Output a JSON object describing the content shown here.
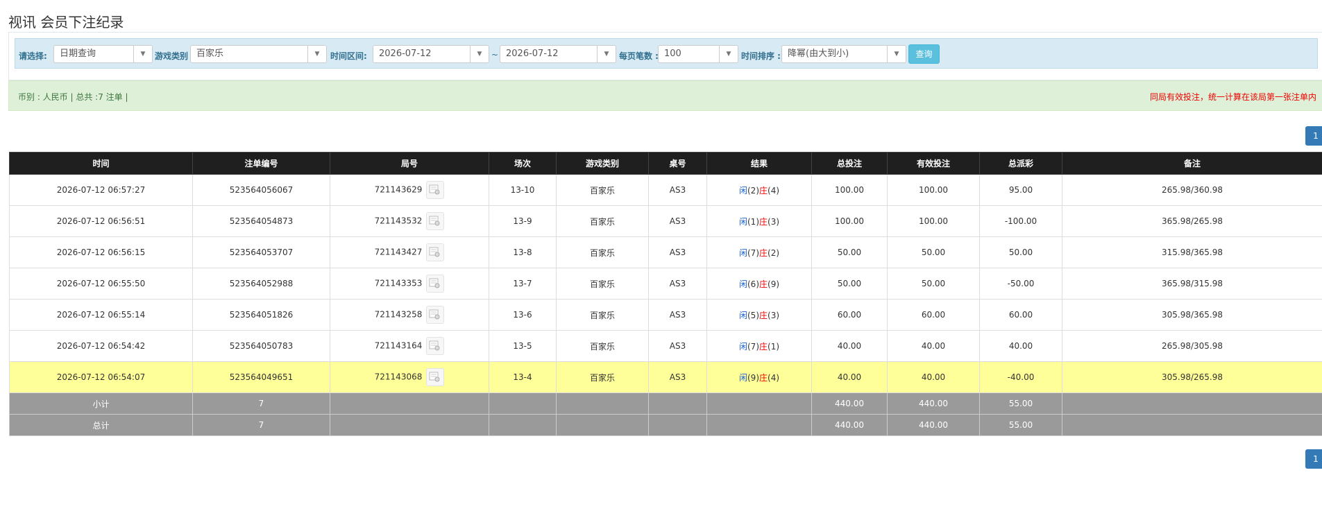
{
  "page": {
    "title": "视讯 会员下注纪录"
  },
  "filters": {
    "select_label": "请选择:",
    "select_value": "日期查询",
    "game_label": "游戏类别",
    "game_value": "百家乐",
    "range_label": "时间区间:",
    "date_from": "2026-07-12",
    "tilde": "~",
    "date_to": "2026-07-12",
    "per_page_label": "每页笔数 :",
    "per_page_value": "100",
    "sort_label": "时间排序 :",
    "sort_value": "降幂(由大到小)",
    "query_button": "查询",
    "dropdown_icon": "caret-down-icon"
  },
  "info": {
    "summary": "币别 : 人民币 | 总共 :7 注单 |",
    "notice": "同局有效投注，统一计算在该局第一张注单内"
  },
  "pagination": {
    "page": "1"
  },
  "table": {
    "headers": [
      "时间",
      "注单编号",
      "局号",
      "场次",
      "游戏类别",
      "桌号",
      "结果",
      "总投注",
      "有效投注",
      "总派彩",
      "备注"
    ],
    "rows": [
      {
        "time": "2026-07-12 06:57:27",
        "bet_no": "523564056067",
        "round_no": "721143629",
        "session": "13-10",
        "game": "百家乐",
        "table": "AS3",
        "player_label": "闲",
        "player_val": "(2)",
        "banker_label": "庄",
        "banker_val": "(4)",
        "total_bet": "100.00",
        "valid_bet": "100.00",
        "payout": "95.00",
        "payout_neg": false,
        "note": "265.98/360.98",
        "highlight": false
      },
      {
        "time": "2026-07-12 06:56:51",
        "bet_no": "523564054873",
        "round_no": "721143532",
        "session": "13-9",
        "game": "百家乐",
        "table": "AS3",
        "player_label": "闲",
        "player_val": "(1)",
        "banker_label": "庄",
        "banker_val": "(3)",
        "total_bet": "100.00",
        "valid_bet": "100.00",
        "payout": "-100.00",
        "payout_neg": true,
        "note": "365.98/265.98",
        "highlight": false
      },
      {
        "time": "2026-07-12 06:56:15",
        "bet_no": "523564053707",
        "round_no": "721143427",
        "session": "13-8",
        "game": "百家乐",
        "table": "AS3",
        "player_label": "闲",
        "player_val": "(7)",
        "banker_label": "庄",
        "banker_val": "(2)",
        "total_bet": "50.00",
        "valid_bet": "50.00",
        "payout": "50.00",
        "payout_neg": false,
        "note": "315.98/365.98",
        "highlight": false
      },
      {
        "time": "2026-07-12 06:55:50",
        "bet_no": "523564052988",
        "round_no": "721143353",
        "session": "13-7",
        "game": "百家乐",
        "table": "AS3",
        "player_label": "闲",
        "player_val": "(6)",
        "banker_label": "庄",
        "banker_val": "(9)",
        "total_bet": "50.00",
        "valid_bet": "50.00",
        "payout": "-50.00",
        "payout_neg": true,
        "note": "365.98/315.98",
        "highlight": false
      },
      {
        "time": "2026-07-12 06:55:14",
        "bet_no": "523564051826",
        "round_no": "721143258",
        "session": "13-6",
        "game": "百家乐",
        "table": "AS3",
        "player_label": "闲",
        "player_val": "(5)",
        "banker_label": "庄",
        "banker_val": "(3)",
        "total_bet": "60.00",
        "valid_bet": "60.00",
        "payout": "60.00",
        "payout_neg": false,
        "note": "305.98/365.98",
        "highlight": false
      },
      {
        "time": "2026-07-12 06:54:42",
        "bet_no": "523564050783",
        "round_no": "721143164",
        "session": "13-5",
        "game": "百家乐",
        "table": "AS3",
        "player_label": "闲",
        "player_val": "(7)",
        "banker_label": "庄",
        "banker_val": "(1)",
        "total_bet": "40.00",
        "valid_bet": "40.00",
        "payout": "40.00",
        "payout_neg": false,
        "note": "265.98/305.98",
        "highlight": false
      },
      {
        "time": "2026-07-12 06:54:07",
        "bet_no": "523564049651",
        "round_no": "721143068",
        "session": "13-4",
        "game": "百家乐",
        "table": "AS3",
        "player_label": "闲",
        "player_val": "(9)",
        "banker_label": "庄",
        "banker_val": "(4)",
        "total_bet": "40.00",
        "valid_bet": "40.00",
        "payout": "-40.00",
        "payout_neg": true,
        "note": "305.98/265.98",
        "highlight": true
      }
    ],
    "subtotal": {
      "label": "小计",
      "count": "7",
      "total_bet": "440.00",
      "valid_bet": "440.00",
      "payout": "55.00"
    },
    "total": {
      "label": "总计",
      "count": "7",
      "total_bet": "440.00",
      "valid_bet": "440.00",
      "payout": "55.00"
    },
    "round_icon": "document-icon"
  },
  "colors": {
    "header_bg": "#1f1f1f",
    "highlight_row": "#ffff99",
    "summary_bg": "#9a9a9a",
    "blue": "#1a5fd6",
    "red": "#e00000"
  }
}
